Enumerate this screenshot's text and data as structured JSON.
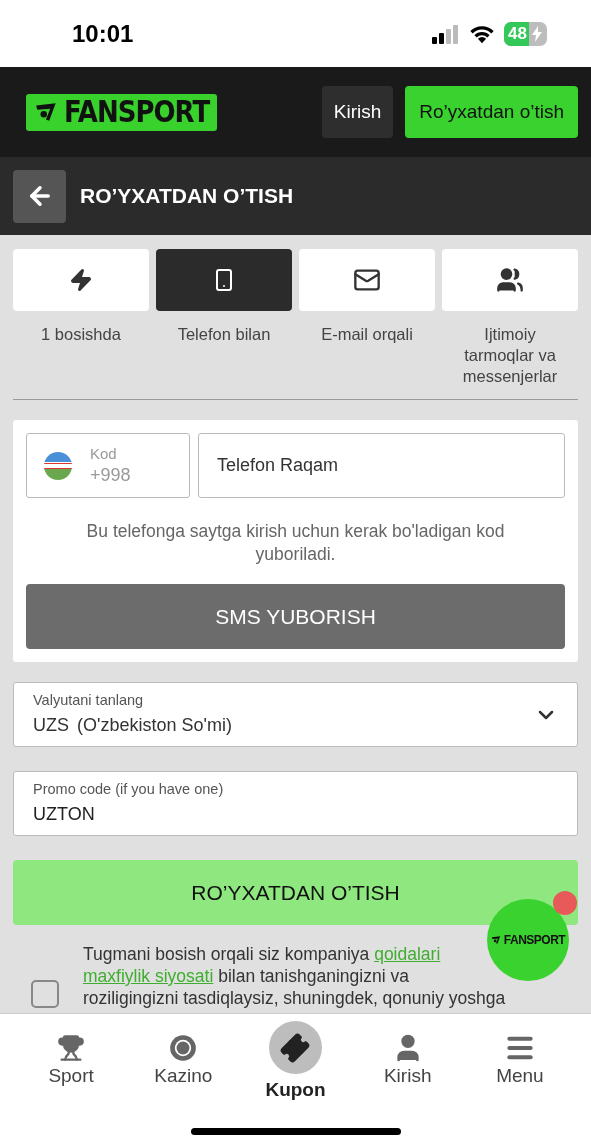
{
  "status_bar": {
    "time": "10:01",
    "battery": "48"
  },
  "header": {
    "logo": "FANSPORT",
    "buttons": [
      {
        "label": "Kirish",
        "kind": "secondary"
      },
      {
        "label": "Ro’yxatdan o’tish",
        "kind": "primary"
      }
    ]
  },
  "page_title": "RO’YXATDAN O’TISH",
  "tabs": [
    {
      "kind": "quick",
      "label": "1 bosishda",
      "selected": false
    },
    {
      "kind": "phone",
      "label": "Telefon bilan",
      "selected": true
    },
    {
      "kind": "email",
      "label": "E-mail orqali",
      "selected": false
    },
    {
      "kind": "social",
      "label": "Ijtimoiy tarmoqlar va messenjerlar",
      "selected": false
    }
  ],
  "phone_form": {
    "code_label": "Kod",
    "code_value": "+998",
    "phone_placeholder": "Telefon Raqam",
    "hint": "Bu telefonga saytga kirish uchun kerak bo'ladigan kod yuboriladi.",
    "button": "SMS YUBORISH"
  },
  "currency": {
    "label": "Valyutani tanlang",
    "code": "UZS",
    "name": "(O'zbekiston So'mi)"
  },
  "promo": {
    "label": "Promo code (if you have one)",
    "value": "UZTON"
  },
  "register_button": "RO’YXATDAN O’TISH",
  "terms": {
    "checked": false,
    "lines": [
      [
        {
          "kind": "text",
          "text": "Tugmani bosish orqali siz kompaniya "
        },
        {
          "kind": "link",
          "text": "qoidalari"
        }
      ],
      [
        {
          "kind": "link",
          "text": "maxfiylik siyosati"
        },
        {
          "kind": "text",
          "text": " bilan tanishganingizni va"
        }
      ],
      [
        {
          "kind": "text",
          "text": "roziligingizni tasdiqlaysiz, shuningdek, qonuniy yoshga"
        }
      ]
    ]
  },
  "floating_button": {
    "logo": "FANSPORT",
    "badge": true
  },
  "bottom_nav": [
    {
      "kind": "sport",
      "label": "Sport",
      "selected": false
    },
    {
      "kind": "casino",
      "label": "Kazino",
      "selected": false
    },
    {
      "kind": "coupon",
      "label": "Kupon",
      "selected": true
    },
    {
      "kind": "login",
      "label": "Kirish",
      "selected": false
    },
    {
      "kind": "menu",
      "label": "Menu",
      "selected": false
    }
  ]
}
